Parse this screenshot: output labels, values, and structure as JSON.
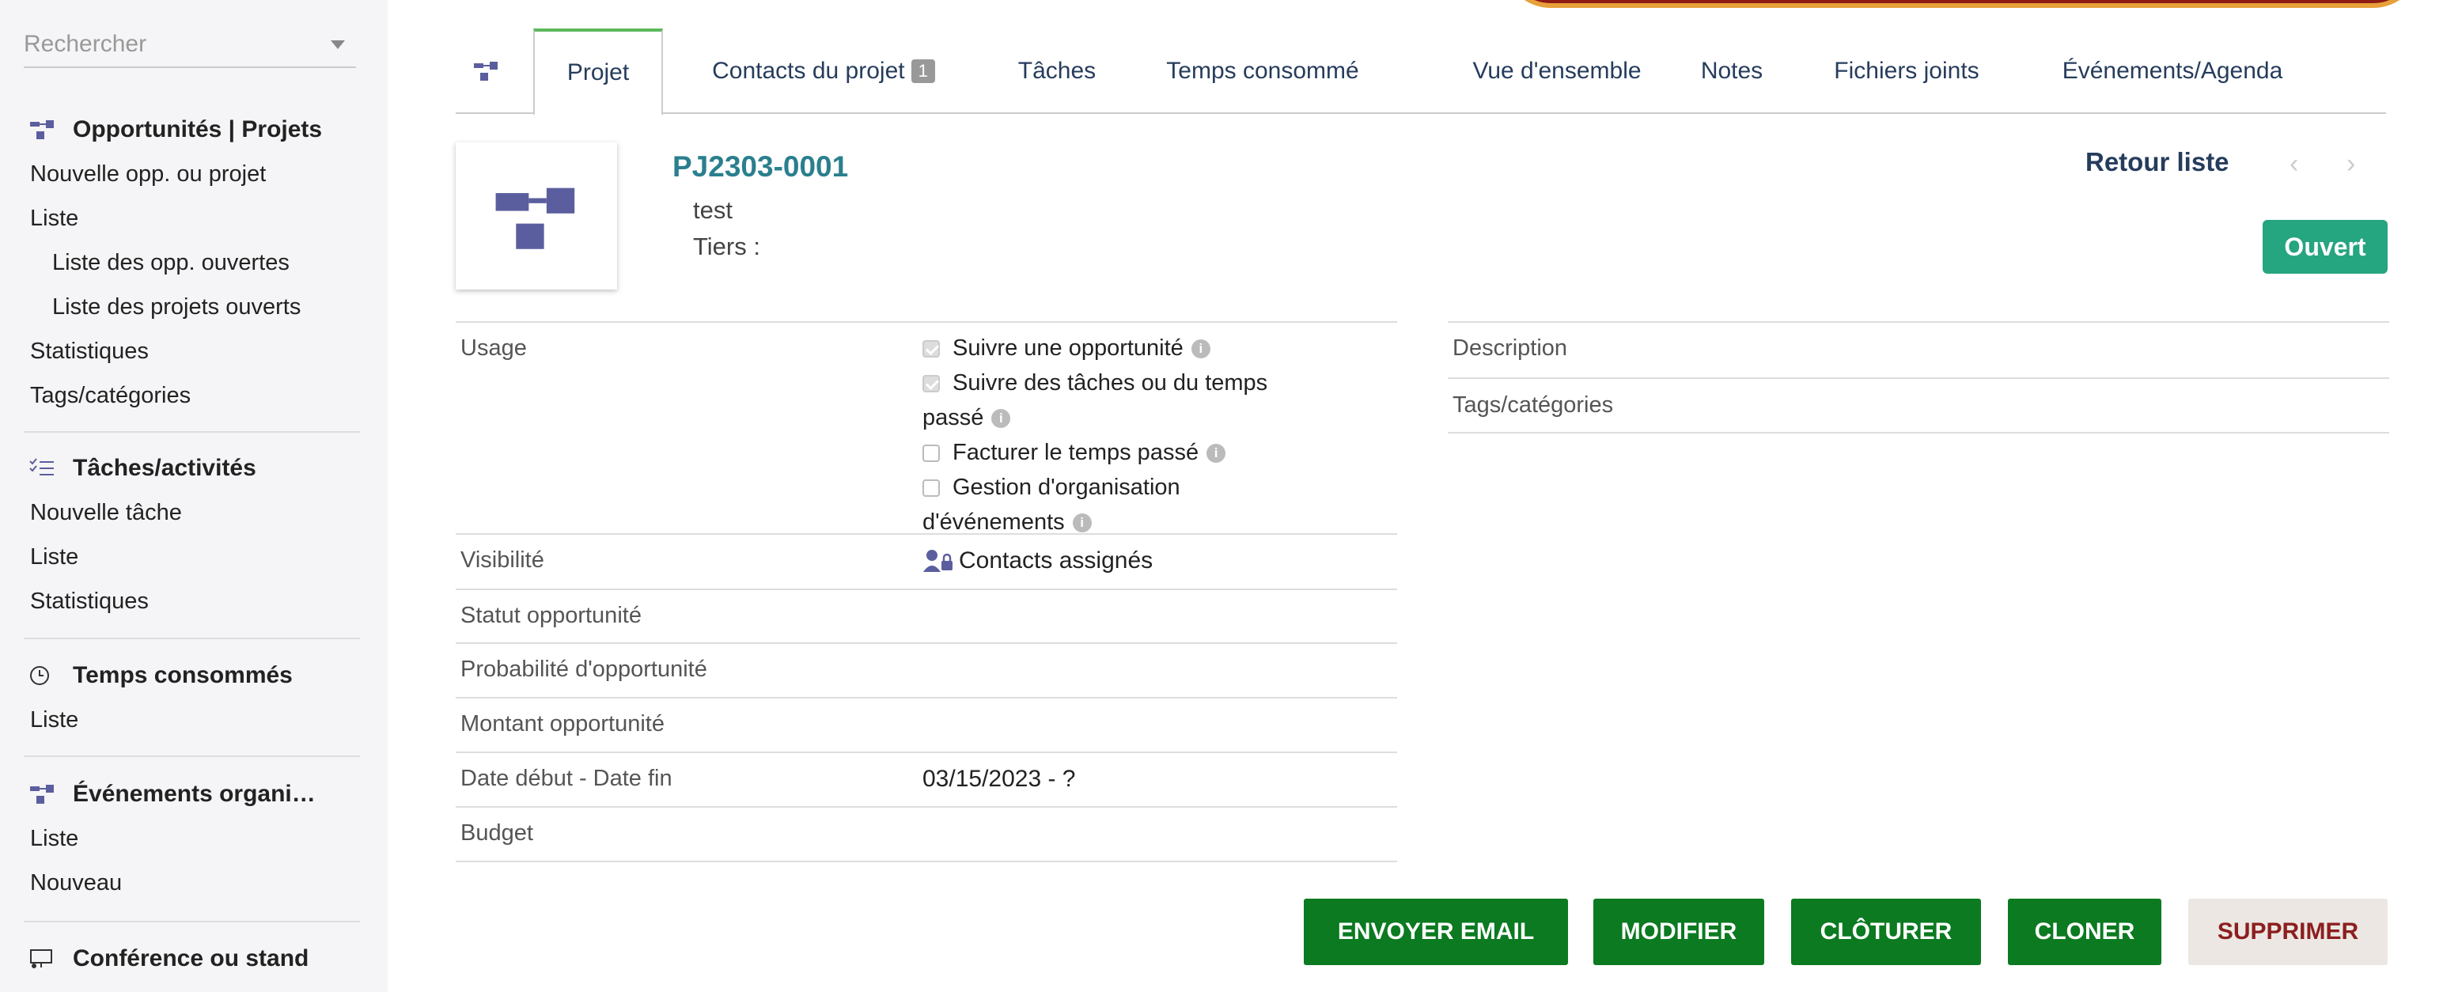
{
  "sidebar": {
    "search_placeholder": "Rechercher",
    "projects": {
      "title": "Opportunités | Projets",
      "items": [
        "Nouvelle opp. ou projet",
        "Liste",
        "Liste des opp. ouvertes",
        "Liste des projets ouverts",
        "Statistiques",
        "Tags/catégories"
      ]
    },
    "tasks": {
      "title": "Tâches/activités",
      "items": [
        "Nouvelle tâche",
        "Liste",
        "Statistiques"
      ]
    },
    "time": {
      "title": "Temps consommés",
      "items": [
        "Liste"
      ]
    },
    "events": {
      "title": "Événements organi…",
      "items": [
        "Liste",
        "Nouveau"
      ]
    },
    "conference": {
      "title": "Conférence ou stand"
    }
  },
  "tabs": {
    "projet": "Projet",
    "contacts": "Contacts du projet",
    "contacts_count": "1",
    "taches": "Tâches",
    "temps": "Temps consommé",
    "vue": "Vue d'ensemble",
    "notes": "Notes",
    "fichiers": "Fichiers joints",
    "evenements": "Événements/Agenda"
  },
  "header": {
    "ref": "PJ2303-0001",
    "label": "test",
    "tiers": "Tiers :",
    "back": "Retour liste",
    "prev": "‹",
    "next": "›",
    "status": "Ouvert"
  },
  "fields": {
    "usage_label": "Usage",
    "usage_1": "Suivre une opportunité",
    "usage_2a": "Suivre des tâches ou du temps",
    "usage_2b": "passé",
    "usage_3": "Facturer le temps passé",
    "usage_4a": "Gestion d'organisation",
    "usage_4b": "d'événements",
    "visibility_label": "Visibilité",
    "visibility_value": "Contacts assignés",
    "opp_status_label": "Statut opportunité",
    "opp_prob_label": "Probabilité d'opportunité",
    "opp_amount_label": "Montant opportunité",
    "dates_label": "Date début - Date fin",
    "dates_value": "03/15/2023 - ?",
    "budget_label": "Budget",
    "description_label": "Description",
    "tags_label": "Tags/catégories"
  },
  "usage_checked": [
    true,
    true,
    false,
    false
  ],
  "actions": {
    "email": "ENVOYER EMAIL",
    "edit": "MODIFIER",
    "close": "CLÔTURER",
    "clone": "CLONER",
    "delete": "SUPPRIMER"
  },
  "colors": {
    "accent_green": "#0b7a20",
    "status_green": "#25a580",
    "ref_teal": "#2a7f8e",
    "icon_purple": "#5b5e9e"
  }
}
